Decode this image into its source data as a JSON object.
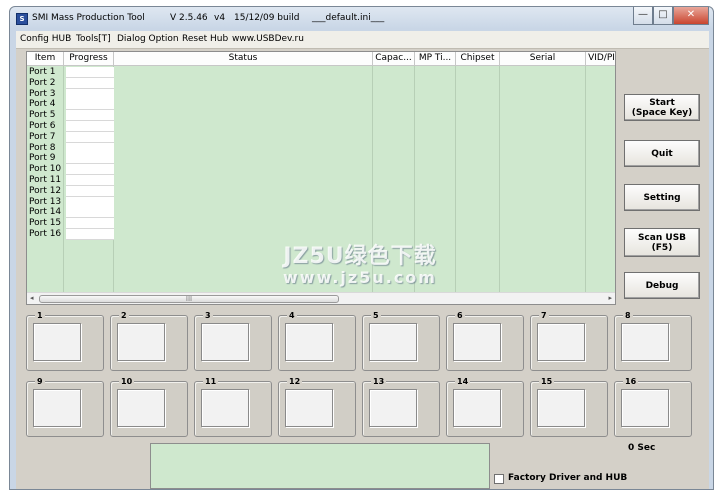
{
  "titlebar": {
    "app_name": "SMI Mass Production Tool",
    "version": "V 2.5.46",
    "build_variant": "v4",
    "build_date": "15/12/09 build",
    "ini_file": "___default.ini___",
    "minimize": "—",
    "maximize": "□",
    "close": "✕"
  },
  "menu": [
    "Config HUB",
    "Tools[T]",
    "Dialog Option",
    "Reset Hub",
    "www.USBDev.ru"
  ],
  "table": {
    "columns": [
      "Item",
      "Progress",
      "Status",
      "Capac...",
      "MP Ti...",
      "Chipset",
      "Serial",
      "VID/PI"
    ],
    "ports": [
      "Port 1",
      "Port 2",
      "Port 3",
      "Port 4",
      "Port 5",
      "Port 6",
      "Port 7",
      "Port 8",
      "Port 9",
      "Port 10",
      "Port 11",
      "Port 12",
      "Port 13",
      "Port 14",
      "Port 15",
      "Port 16"
    ],
    "scroll_left": "◂",
    "scroll_right": "▸",
    "scroll_grip": "III"
  },
  "buttons": {
    "start": "Start\n(Space Key)",
    "quit": "Quit",
    "setting": "Setting",
    "scan_usb": "Scan USB\n(F5)",
    "debug": "Debug"
  },
  "slots": [
    "1",
    "2",
    "3",
    "4",
    "5",
    "6",
    "7",
    "8",
    "9",
    "10",
    "11",
    "12",
    "13",
    "14",
    "15",
    "16"
  ],
  "timer": "0 Sec",
  "factory_checkbox_label": "Factory Driver and HUB",
  "watermark": {
    "line1": "JZ5U绿色下载",
    "line2": "www.jz5u.com"
  },
  "colors": {
    "list_bg": "#cfe8ce",
    "window_bg": "#d4d0c8"
  }
}
